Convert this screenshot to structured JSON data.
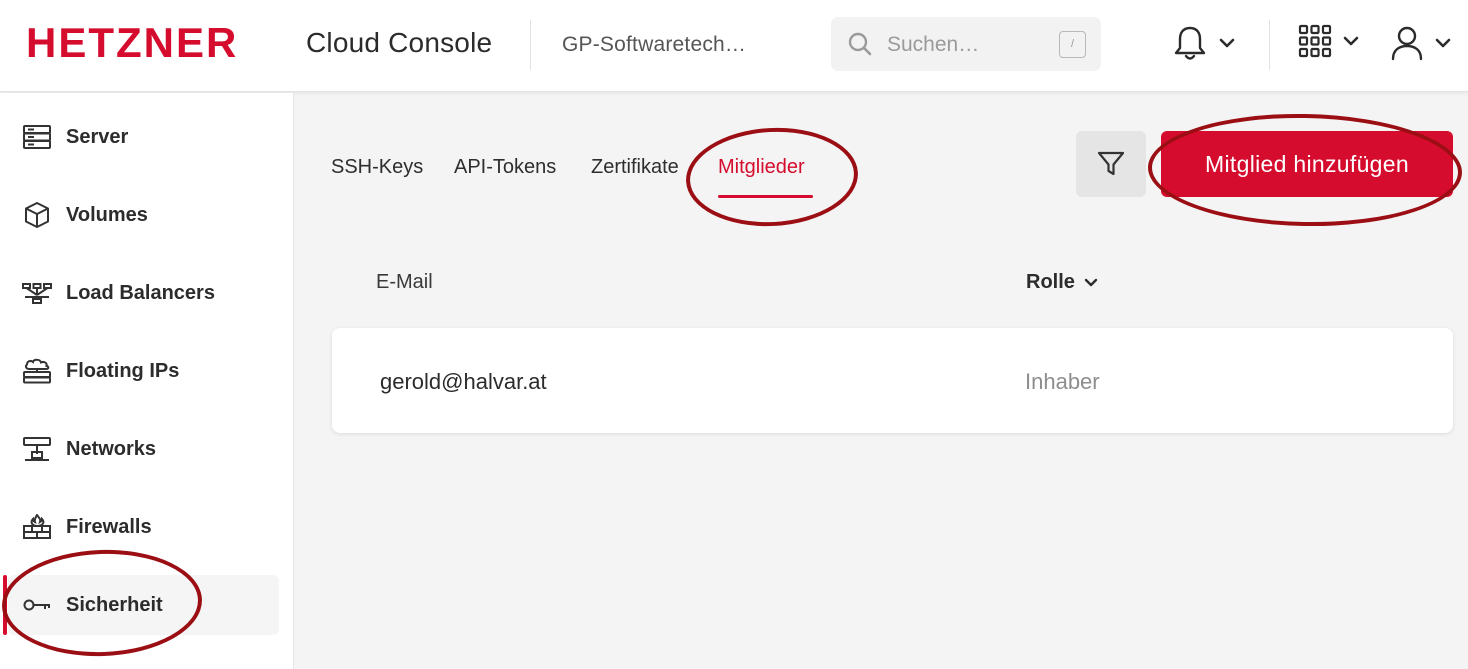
{
  "header": {
    "brand": "HETZNER",
    "app_title": "Cloud Console",
    "project": "GP-Softwaretech…",
    "search_placeholder": "Suchen…",
    "search_shortcut": "/"
  },
  "sidebar": {
    "items": [
      {
        "label": "Server",
        "icon": "server-icon"
      },
      {
        "label": "Volumes",
        "icon": "cube-icon"
      },
      {
        "label": "Load Balancers",
        "icon": "load-balancer-icon"
      },
      {
        "label": "Floating IPs",
        "icon": "floating-ip-icon"
      },
      {
        "label": "Networks",
        "icon": "network-icon"
      },
      {
        "label": "Firewalls",
        "icon": "firewall-icon"
      },
      {
        "label": "Sicherheit",
        "icon": "key-icon",
        "active": true
      }
    ]
  },
  "main": {
    "tabs": [
      {
        "label": "SSH-Keys"
      },
      {
        "label": "API-Tokens"
      },
      {
        "label": "Zertifikate"
      },
      {
        "label": "Mitglieder",
        "active": true
      }
    ],
    "add_button": "Mitglied hinzufügen",
    "columns": {
      "email": "E-Mail",
      "role": "Rolle"
    },
    "rows": [
      {
        "email": "gerold@halvar.at",
        "role": "Inhaber"
      }
    ]
  },
  "colors": {
    "brand_red": "#d50c2d",
    "annotation": "#9b0e14"
  }
}
